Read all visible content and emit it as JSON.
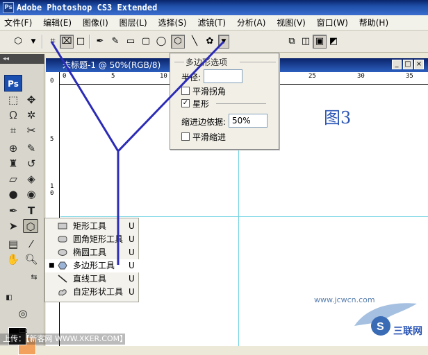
{
  "app": {
    "logo": "Ps",
    "title": "Adobe Photoshop CS3 Extended"
  },
  "menu": [
    "文件(F)",
    "编辑(E)",
    "图像(I)",
    "图层(L)",
    "选择(S)",
    "滤镜(T)",
    "分析(A)",
    "视图(V)",
    "窗口(W)",
    "帮助(H)"
  ],
  "options_bar": {
    "sides_label": "边:",
    "sides_value": "5"
  },
  "toolbox": {
    "logo": "Ps"
  },
  "document": {
    "title": "未标题-1 @ 50%(RGB/8)",
    "ruler_h": [
      "0",
      "5",
      "10",
      "15",
      "20",
      "25",
      "30",
      "35"
    ],
    "ruler_v": [
      "0",
      "5",
      "1",
      "0",
      "1",
      "5"
    ],
    "figure_label": "图3"
  },
  "polygon_options": {
    "title": "多边形选项",
    "radius_label": "半径:",
    "radius_value": "",
    "smooth_corners": "平滑拐角",
    "smooth_corners_checked": false,
    "star": "星形",
    "star_checked": true,
    "indent_label": "缩进边依据:",
    "indent_value": "50%",
    "smooth_indents": "平滑缩进",
    "smooth_indents_checked": false
  },
  "tool_flyout": [
    {
      "label": "矩形工具",
      "key": "U",
      "icon": "rectangle-icon",
      "active": false
    },
    {
      "label": "圆角矩形工具",
      "key": "U",
      "icon": "rounded-rect-icon",
      "active": false
    },
    {
      "label": "椭圆工具",
      "key": "U",
      "icon": "ellipse-icon",
      "active": false
    },
    {
      "label": "多边形工具",
      "key": "U",
      "icon": "polygon-icon",
      "active": true
    },
    {
      "label": "直线工具",
      "key": "U",
      "icon": "line-icon",
      "active": false
    },
    {
      "label": "自定形状工具",
      "key": "U",
      "icon": "custom-shape-icon",
      "active": false
    }
  ],
  "colors": {
    "foreground": "#000000",
    "background": "#f3a25e",
    "annotation": "#2b2bb8"
  },
  "footer": {
    "text": "上传：【新客网 WWW.XKER.COM】"
  },
  "watermark": {
    "text": "www.jcwcn.com",
    "logo_text": "S 三联网"
  }
}
